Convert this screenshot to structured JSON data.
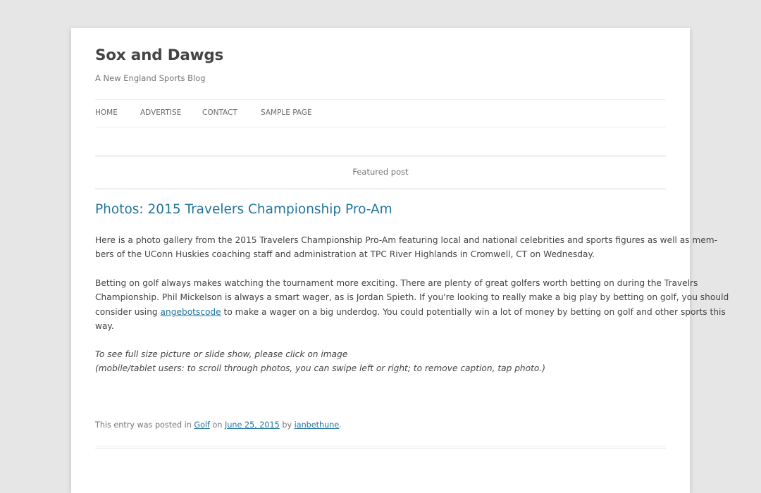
{
  "site": {
    "title": "Sox and Dawgs",
    "description": "A New England Sports Blog"
  },
  "nav": {
    "items": [
      "HOME",
      "ADVERTISE",
      "CONTACT",
      "SAMPLE PAGE"
    ]
  },
  "featured_label": "Featured post",
  "post": {
    "title": "Photos: 2015 Travelers Championship Pro-Am",
    "para1": [
      "Here is a photo gallery from the 2015 Travelers Championship Pro-Am featuring local and national celebrities and sports figures as well as mem-",
      "bers of the UConn Huskies coaching staff and administration at TPC River Highlands in Cromwell, CT on Wednesday."
    ],
    "para2": {
      "line1": "Betting on golf always makes watching the tournament more exciting.  There are plenty of great golfers worth betting on during the Travelrs",
      "line2": "Championship.  Phil Mickelson is always a smart wager, as is Jordan Spieth.  If you're looking to really make a big play by betting on golf, you should",
      "line3_before": "consider using ",
      "link_text": "angebotscode",
      "line3_after": " to make a wager on a big underdog.  You could potentially win a lot of money by betting on golf and other sports this",
      "line4": "way."
    },
    "para3": [
      "To see full size picture or slide show, please click on image",
      "(mobile/tablet users: to scroll through photos, you can swipe left or right; to remove caption, tap photo.)"
    ],
    "meta": {
      "prefix": "This entry was posted in ",
      "category": "Golf",
      "on_text": " on ",
      "date": "June 25, 2015",
      "by_text": " by ",
      "author": "ianbethune",
      "suffix": "."
    }
  }
}
